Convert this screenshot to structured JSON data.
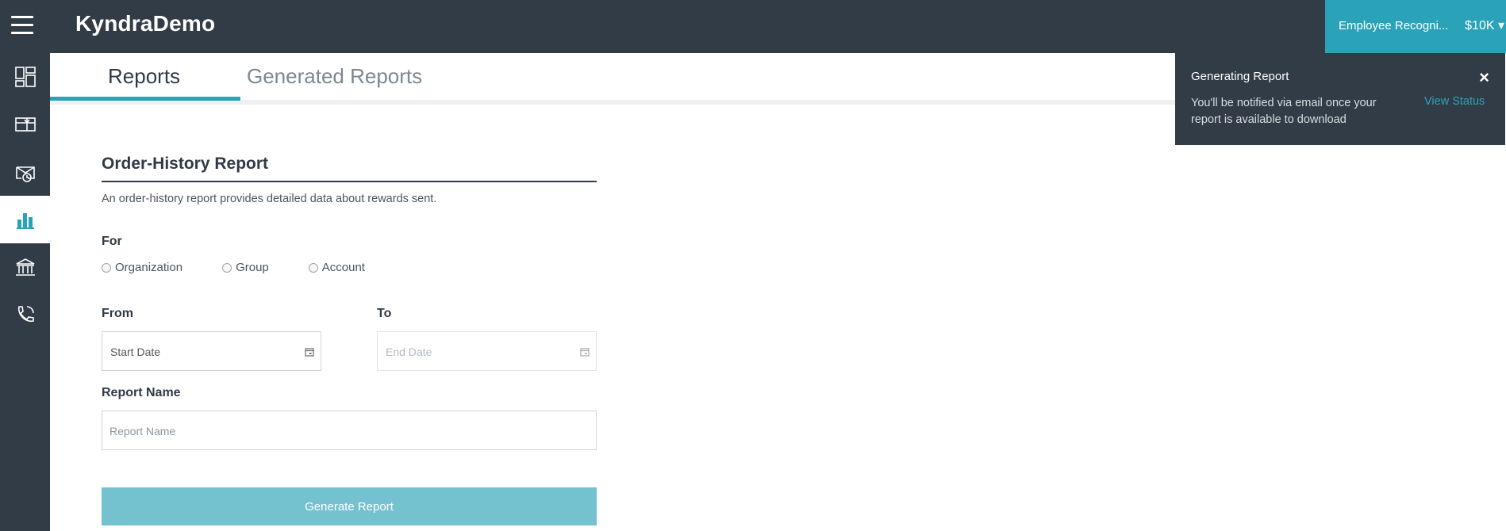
{
  "header": {
    "brand": "KyndraDemo",
    "account_name": "Employee Recogni...",
    "balance": "$10K ▾"
  },
  "sidebar": {
    "items": [
      {
        "name": "dashboard-icon"
      },
      {
        "name": "gift-card-icon"
      },
      {
        "name": "scheduled-rewards-icon"
      },
      {
        "name": "reports-bar-chart-icon",
        "active": true
      },
      {
        "name": "bank-icon"
      },
      {
        "name": "phone-support-icon"
      }
    ],
    "accent": "#2aa3b8"
  },
  "tabs": {
    "reports": "Reports",
    "generated": "Generated Reports"
  },
  "form": {
    "title": "Order-History Report",
    "description": "An order-history report provides detailed data about rewards sent.",
    "for_label": "For",
    "radio_options": [
      "Organization",
      "Group",
      "Account"
    ],
    "from_label": "From",
    "to_label": "To",
    "start_placeholder": "Start Date",
    "end_placeholder": "End Date",
    "name_label": "Report Name",
    "name_placeholder": "Report Name",
    "submit_label": "Generate Report"
  },
  "toast": {
    "title": "Generating Report",
    "close": "×",
    "message": "You'll be notified via email once your report is available to download",
    "link": "View Status"
  }
}
